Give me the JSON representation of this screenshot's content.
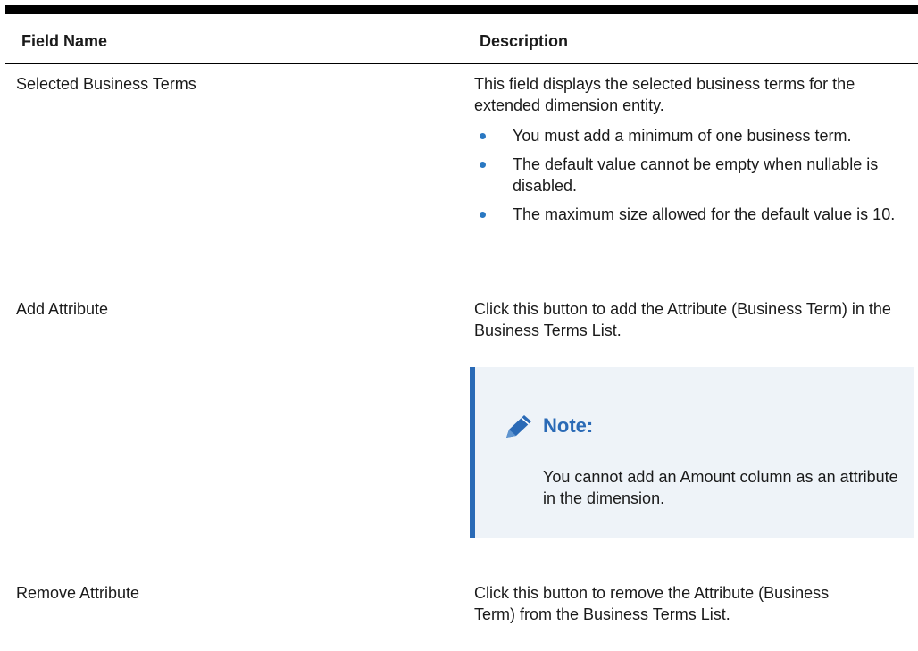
{
  "table": {
    "headers": {
      "field": "Field Name",
      "description": "Description"
    },
    "rows": [
      {
        "field": "Selected Business Terms",
        "description": "This field displays the selected business terms for the extended dimension entity.",
        "bullets": [
          "You must add a minimum of one business term.",
          "The default value cannot be empty when nullable is disabled.",
          "The maximum size allowed for the default value is 10."
        ]
      },
      {
        "field": "Add Attribute",
        "description": "Click this button to add the Attribute (Business Term) in the Business Terms List.",
        "note": {
          "icon": "pencil-icon",
          "title": "Note:",
          "text": "You cannot add an Amount column as an attribute in the dimension."
        }
      },
      {
        "field": "Remove Attribute",
        "description": "Click this button to remove the Attribute (Business Term) from the Business Terms List."
      }
    ]
  },
  "colors": {
    "accent": "#2a6ab6",
    "bullet": "#2a78c2",
    "note_bg": "#eef3f8"
  }
}
